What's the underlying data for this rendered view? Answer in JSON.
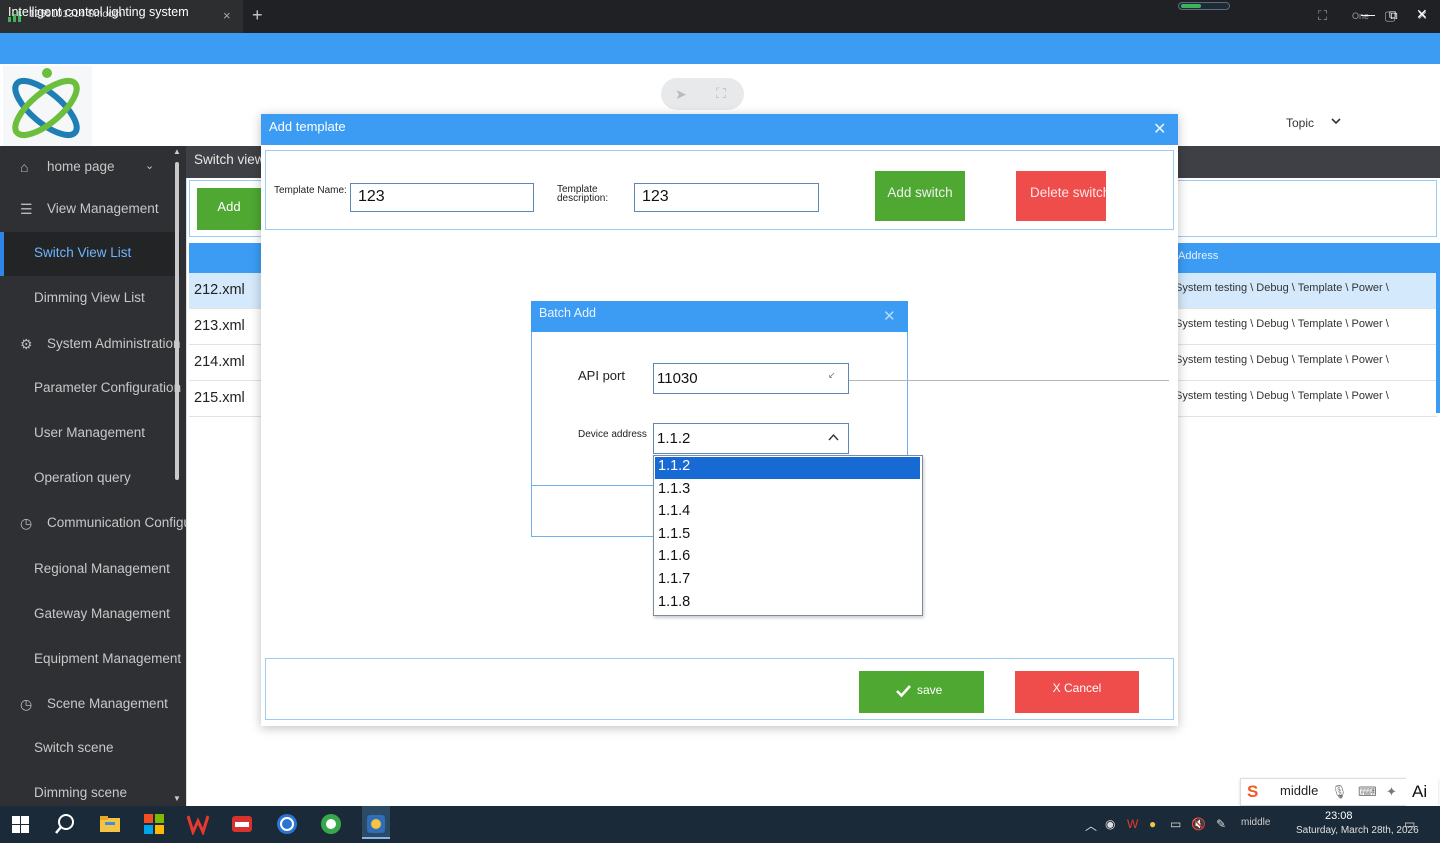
{
  "remote_tab": {
    "title": "1259101314 Smooth",
    "close": "×",
    "new_tab": "+",
    "one_label": "One"
  },
  "app": {
    "title": "Intelligent control lighting system",
    "window_controls": [
      "minimize-icon",
      "restore-icon",
      "close-icon"
    ]
  },
  "header": {
    "topic_label": "Topic"
  },
  "sidebar": {
    "items": [
      {
        "label": "home page",
        "icon": "home-icon"
      },
      {
        "label": "View Management",
        "icon": "list-icon"
      },
      {
        "label": "Switch View List",
        "active": true
      },
      {
        "label": "Dimming View List"
      },
      {
        "label": "System Administration",
        "icon": "gear-icon"
      },
      {
        "label": "Parameter Configuration"
      },
      {
        "label": "User Management"
      },
      {
        "label": "Operation query"
      },
      {
        "label": "Communication Configuration",
        "icon": "clock-icon"
      },
      {
        "label": "Regional Management"
      },
      {
        "label": "Gateway Management"
      },
      {
        "label": "Equipment Management"
      },
      {
        "label": "Scene Management",
        "icon": "clock-icon"
      },
      {
        "label": "Switch scene"
      },
      {
        "label": "Dimming scene"
      }
    ]
  },
  "background_page": {
    "breadcrumb": "Switch view",
    "add_button": "Add",
    "address_header": "Address",
    "rows": [
      {
        "file": "212.xml",
        "address": "System testing \\ Debug \\ Template \\ Power \\"
      },
      {
        "file": "213.xml",
        "address": "System testing \\ Debug \\ Template \\ Power \\"
      },
      {
        "file": "214.xml",
        "address": "System testing \\ Debug \\ Template \\ Power \\"
      },
      {
        "file": "215.xml",
        "address": "System testing \\ Debug \\ Template \\ Power \\"
      }
    ]
  },
  "add_template": {
    "title": "Add template",
    "template_name_label": "Template Name:",
    "template_name_value": "123",
    "template_desc_label": "Template description:",
    "template_desc_value": "123",
    "add_switch": "Add switch",
    "delete_switch": "Delete switch",
    "save": "save",
    "cancel": "X Cancel"
  },
  "batch_add": {
    "title": "Batch Add",
    "api_port_label": "API port",
    "api_port_value": "11030",
    "device_address_label": "Device address",
    "device_address_value": "1.1.2",
    "options": [
      "1.1.2",
      "1.1.3",
      "1.1.4",
      "1.1.5",
      "1.1.6",
      "1.1.7",
      "1.1.8"
    ],
    "selected_index": 0
  },
  "ime": {
    "text": "middle",
    "ai": "Ai"
  },
  "taskbar": {
    "time": "23:08",
    "date": "Saturday, March 28th, 2026",
    "tray_text": "middle"
  },
  "colors": {
    "accent": "#3c9cf4",
    "green": "#4ea832",
    "red": "#ef4c4c",
    "sidebar": "#2f3033"
  }
}
